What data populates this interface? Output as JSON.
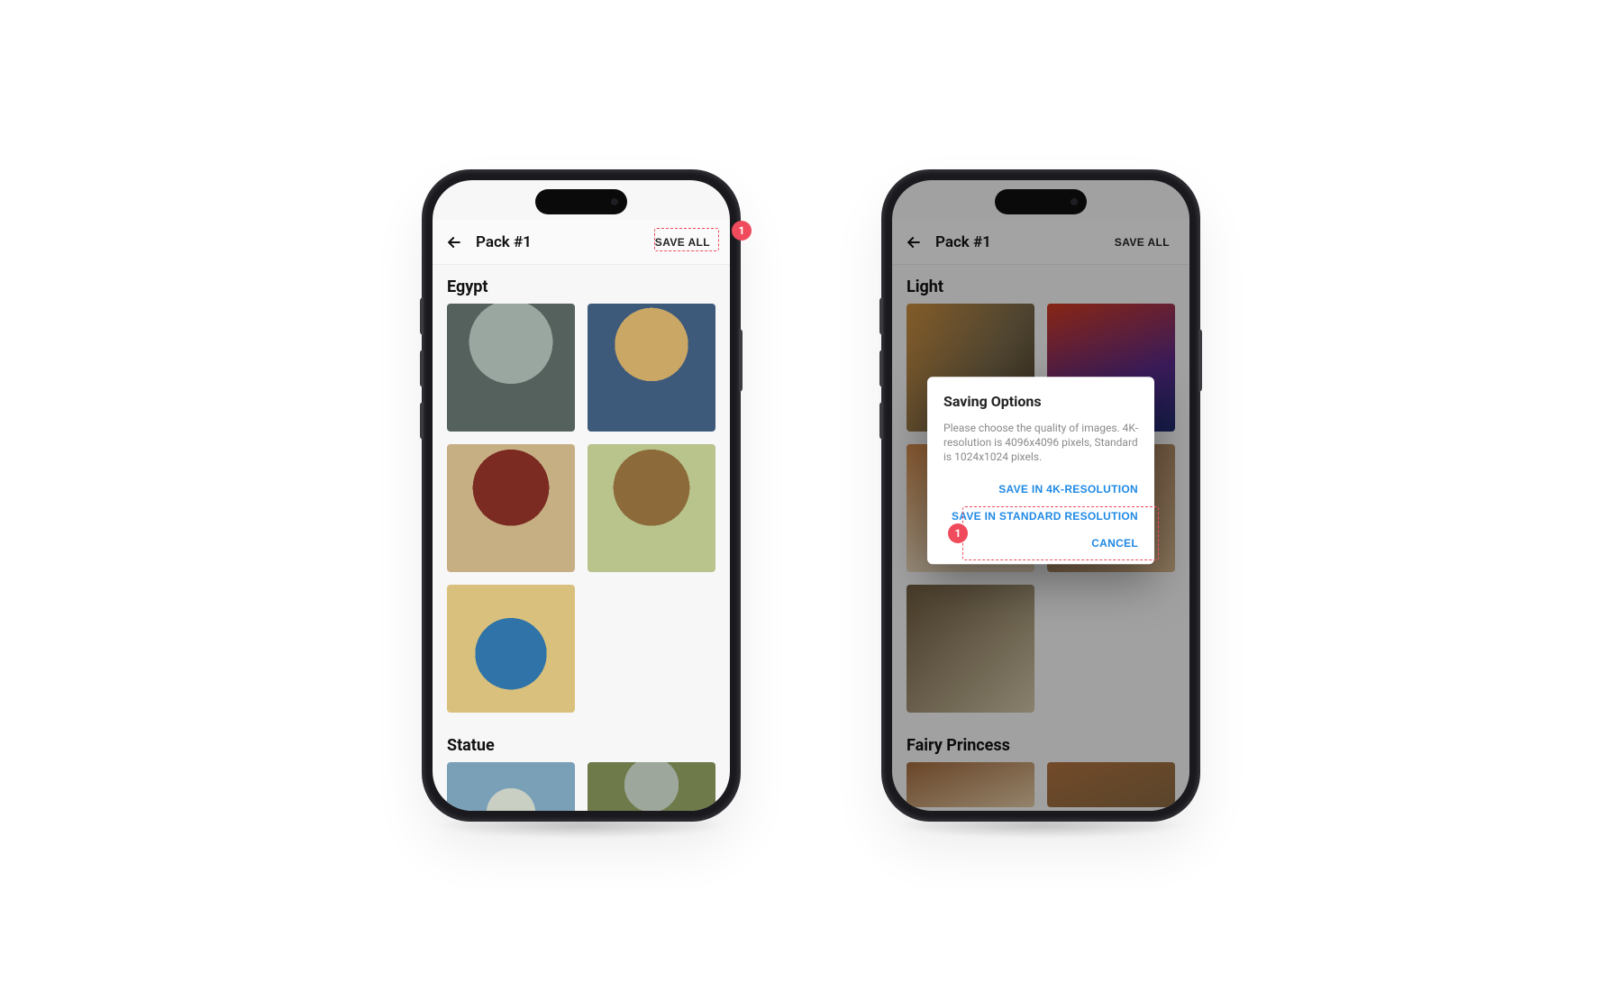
{
  "left": {
    "header": {
      "title": "Pack #1",
      "save_all": "SAVE ALL"
    },
    "sections": [
      {
        "title": "Egypt"
      },
      {
        "title": "Statue"
      }
    ],
    "callout": "1"
  },
  "right": {
    "header": {
      "title": "Pack #1",
      "save_all": "SAVE ALL"
    },
    "sections": [
      {
        "title": "Light"
      },
      {
        "title": "Fairy Princess"
      }
    ],
    "dialog": {
      "title": "Saving Options",
      "body": "Please choose the quality of images. 4K-resolution is 4096x4096 pixels, Standard is 1024x1024 pixels.",
      "save_4k": "SAVE IN 4K-RESOLUTION",
      "save_std": "SAVE IN STANDARD RESOLUTION",
      "cancel": "CANCEL"
    },
    "callout": "1"
  }
}
